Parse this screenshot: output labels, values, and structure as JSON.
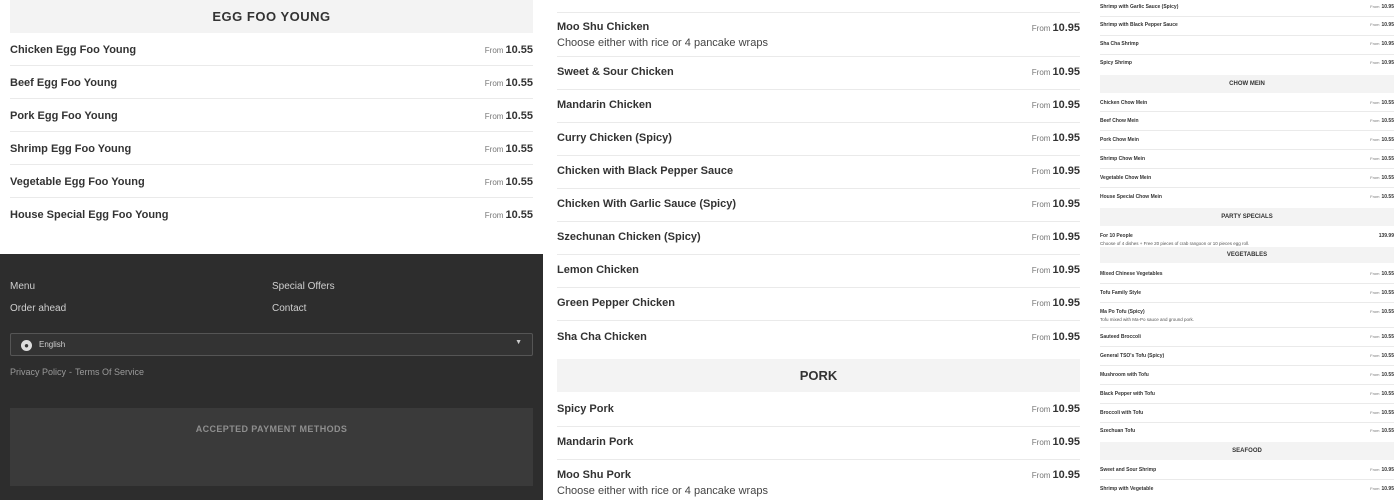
{
  "left": {
    "section_title": "EGG FOO YOUNG",
    "items": [
      {
        "name": "Chicken Egg Foo Young",
        "from": "From",
        "price": "10.55"
      },
      {
        "name": "Beef Egg Foo Young",
        "from": "From",
        "price": "10.55"
      },
      {
        "name": "Pork Egg Foo Young",
        "from": "From",
        "price": "10.55"
      },
      {
        "name": "Shrimp Egg Foo Young",
        "from": "From",
        "price": "10.55"
      },
      {
        "name": "Vegetable Egg Foo Young",
        "from": "From",
        "price": "10.55"
      },
      {
        "name": "House Special Egg Foo Young",
        "from": "From",
        "price": "10.55"
      }
    ]
  },
  "footer": {
    "links": [
      "Menu",
      "Special Offers",
      "Order ahead",
      "Contact"
    ],
    "language": "English",
    "privacy": "Privacy Policy",
    "separator": "-",
    "terms": "Terms Of Service",
    "payment_label": "ACCEPTED PAYMENT METHODS"
  },
  "middle": {
    "items": [
      {
        "name": "Moo Shu Chicken",
        "desc": "Choose either with rice or 4 pancake wraps",
        "from": "From",
        "price": "10.95"
      },
      {
        "name": "Sweet & Sour Chicken",
        "from": "From",
        "price": "10.95"
      },
      {
        "name": "Mandarin Chicken",
        "from": "From",
        "price": "10.95"
      },
      {
        "name": "Curry Chicken (Spicy)",
        "from": "From",
        "price": "10.95"
      },
      {
        "name": "Chicken with Black Pepper Sauce",
        "from": "From",
        "price": "10.95"
      },
      {
        "name": "Chicken With Garlic Sauce (Spicy)",
        "from": "From",
        "price": "10.95"
      },
      {
        "name": "Szechunan Chicken (Spicy)",
        "from": "From",
        "price": "10.95"
      },
      {
        "name": "Lemon Chicken",
        "from": "From",
        "price": "10.95"
      },
      {
        "name": "Green Pepper Chicken",
        "from": "From",
        "price": "10.95"
      },
      {
        "name": "Sha Cha Chicken",
        "from": "From",
        "price": "10.95"
      }
    ],
    "pork_title": "PORK",
    "pork_items": [
      {
        "name": "Spicy Pork",
        "from": "From",
        "price": "10.95"
      },
      {
        "name": "Mandarin Pork",
        "from": "From",
        "price": "10.95"
      },
      {
        "name": "Moo Shu Pork",
        "desc": "Choose either with rice or 4 pancake wraps",
        "from": "From",
        "price": "10.95"
      }
    ]
  },
  "right": {
    "shrimp_items": [
      {
        "name": "Shrimp with Garlic Sauce (Spicy)",
        "from": "From",
        "price": "10.95"
      },
      {
        "name": "Shrimp with Black Pepper Sauce",
        "from": "From",
        "price": "10.95"
      },
      {
        "name": "Sha Cha Shrimp",
        "from": "From",
        "price": "10.95"
      },
      {
        "name": "Spicy Shrimp",
        "from": "From",
        "price": "10.95"
      }
    ],
    "chow_mein_title": "CHOW MEIN",
    "chow_mein_items": [
      {
        "name": "Chicken Chow Mein",
        "from": "From",
        "price": "10.55"
      },
      {
        "name": "Beef Chow Mein",
        "from": "From",
        "price": "10.55"
      },
      {
        "name": "Pork Chow Mein",
        "from": "From",
        "price": "10.55"
      },
      {
        "name": "Shrimp Chow Mein",
        "from": "From",
        "price": "10.55"
      },
      {
        "name": "Vegetable Chow Mein",
        "from": "From",
        "price": "10.55"
      },
      {
        "name": "House Special Chow Mein",
        "from": "From",
        "price": "10.55"
      }
    ],
    "party_title": "PARTY SPECIALS",
    "party_item": {
      "name": "For 10 People",
      "desc": "Choose of 4 dishes + Free 20 pieces of crab rangoon or 10 pieces egg roll.",
      "price": "139.99"
    },
    "vegetables_title": "VEGETABLES",
    "vegetable_items": [
      {
        "name": "Mixed Chinese Vegetables",
        "from": "From",
        "price": "10.55"
      },
      {
        "name": "Tofu Family Style",
        "from": "From",
        "price": "10.55"
      },
      {
        "name": "Ma Po Tofu (Spicy)",
        "desc": "Tofu mixed with Ma-Po sauce and ground pork.",
        "from": "From",
        "price": "10.55"
      },
      {
        "name": "Sauteed Broccoli",
        "from": "From",
        "price": "10.55"
      },
      {
        "name": "General TSO's Tofu (Spicy)",
        "from": "From",
        "price": "10.55"
      },
      {
        "name": "Mushroom with Tofu",
        "from": "From",
        "price": "10.55"
      },
      {
        "name": "Black Pepper with Tofu",
        "from": "From",
        "price": "10.55"
      },
      {
        "name": "Broccoli with Tofu",
        "from": "From",
        "price": "10.55"
      },
      {
        "name": "Szechuan Tofu",
        "from": "From",
        "price": "10.55"
      }
    ],
    "seafood_title": "SEAFOOD",
    "seafood_items": [
      {
        "name": "Sweet and Sour Shrimp",
        "from": "From",
        "price": "10.95"
      },
      {
        "name": "Shrimp with Vegetable",
        "from": "From",
        "price": "10.95"
      }
    ]
  }
}
